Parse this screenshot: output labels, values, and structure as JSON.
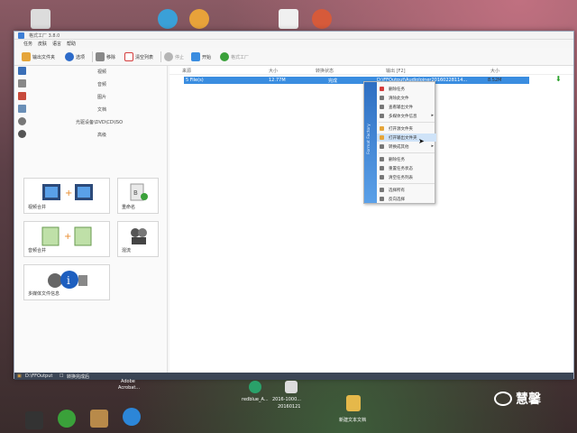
{
  "window": {
    "title": "格式工厂 3.8.0",
    "menu": [
      "任务",
      "皮肤",
      "语言",
      "帮助"
    ]
  },
  "toolbar": {
    "buttons": [
      {
        "label": "输出文件夹",
        "icon": "folder-icon",
        "color": "#e5a53a"
      },
      {
        "label": "选项",
        "icon": "gear-icon",
        "color": "#2d6bc9"
      },
      {
        "label": "移除",
        "icon": "delete-icon",
        "color": "#888888"
      },
      {
        "label": "清空列表",
        "icon": "clear-list-icon",
        "color": "#d43c3c"
      },
      {
        "label": "停止",
        "icon": "stop-icon",
        "color": "#999999"
      },
      {
        "label": "开始",
        "icon": "start-icon",
        "color": "#3a8de0"
      },
      {
        "label": "格式工厂",
        "icon": "format-factory-icon",
        "color": "#3aa13a"
      }
    ]
  },
  "sidebar": {
    "categories": [
      {
        "label": "视频",
        "icon": "video-icon",
        "color": "#3a6fb7"
      },
      {
        "label": "音频",
        "icon": "audio-icon",
        "color": "#888888"
      },
      {
        "label": "图片",
        "icon": "picture-icon",
        "color": "#c74a3c"
      },
      {
        "label": "文档",
        "icon": "document-icon",
        "color": "#6a8fb7"
      },
      {
        "label": "光驱设备\\DVD\\CD\\ISO",
        "icon": "disc-icon",
        "color": "#777777"
      },
      {
        "label": "高级",
        "icon": "advanced-icon",
        "color": "#555555"
      }
    ],
    "tiles": [
      {
        "label": "视频合并",
        "icon": "video-merge-icon"
      },
      {
        "label": "重命名",
        "icon": "rename-icon"
      },
      {
        "label": "音频合并",
        "icon": "audio-merge-icon"
      },
      {
        "label": "混流",
        "icon": "mux-icon"
      },
      {
        "label": "多媒体文件信息",
        "icon": "media-info-icon"
      }
    ]
  },
  "list": {
    "headers": [
      "来源",
      "大小",
      "转换状态",
      "输出 [F2]",
      "大小"
    ],
    "row": {
      "source": "5 File(s)",
      "size": "12.77M",
      "status": "完成",
      "output": "D:\\FFOutput\\AudioJoiner20160228114...",
      "out_size": "8.52M"
    }
  },
  "context_menu": {
    "band_text": "Format Factory",
    "items": [
      {
        "label": "删除任务",
        "icon": "x-icon",
        "color": "#d43c3c",
        "submenu": false
      },
      {
        "label": "清除此文件",
        "icon": "clear-file-icon",
        "color": "#777777",
        "submenu": false
      },
      {
        "label": "查看输出文件",
        "icon": "view-output-icon",
        "color": "#777777",
        "submenu": false
      },
      {
        "label": "多媒体文件信息",
        "icon": "info-icon",
        "color": "#777777",
        "submenu": true
      },
      {
        "label": "打开源文件夹",
        "icon": "open-source-folder-icon",
        "color": "#e5a53a",
        "submenu": false,
        "sep_before": true
      },
      {
        "label": "打开输出文件夹",
        "icon": "open-output-folder-icon",
        "color": "#e5a53a",
        "submenu": false,
        "hover": true
      },
      {
        "label": "转换成其他",
        "icon": "convert-icon",
        "color": "#777777",
        "submenu": true
      },
      {
        "label": "删除任务",
        "icon": "remove-task-icon",
        "color": "#777777",
        "submenu": false,
        "sep_before": true
      },
      {
        "label": "重置任务状态",
        "icon": "reset-icon",
        "color": "#777777",
        "submenu": false
      },
      {
        "label": "清空任务列表",
        "icon": "clear-tasks-icon",
        "color": "#777777",
        "submenu": false
      },
      {
        "label": "选择所有",
        "icon": "select-all-icon",
        "color": "#777777",
        "submenu": false,
        "sep_before": true
      },
      {
        "label": "反向选择",
        "icon": "invert-icon",
        "color": "#777777",
        "submenu": false
      }
    ]
  },
  "statusbar": {
    "output": "D:\\FFOutput",
    "option": "转换完成后"
  },
  "desktop": {
    "taskbar_labels": [
      "Adobe",
      "Acrobat...",
      "redblue_A...",
      "2016-1000...",
      "20160121",
      "新建文本文档"
    ],
    "watermark": "慧馨"
  }
}
